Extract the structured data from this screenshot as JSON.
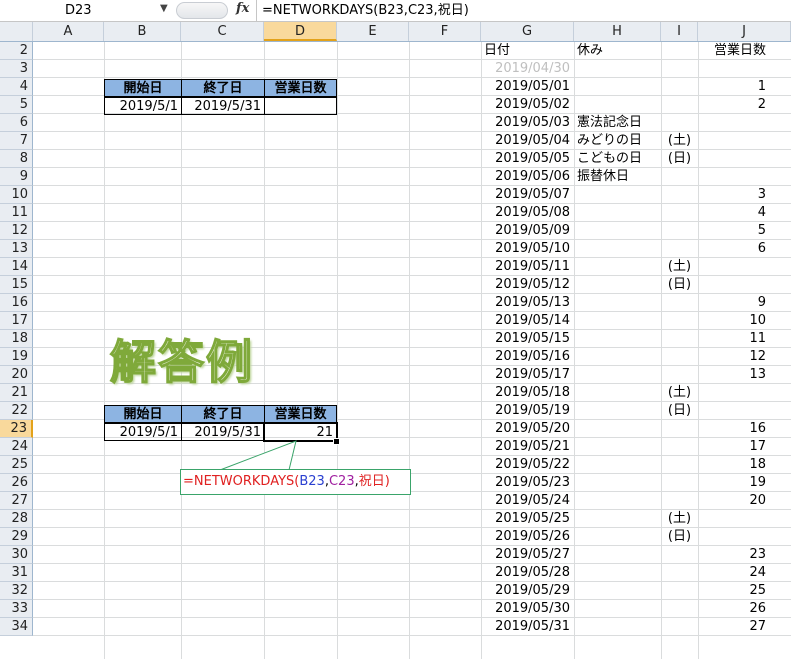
{
  "formula_bar": {
    "name_box": "D23",
    "fx_label": "fx",
    "formula": "=NETWORKDAYS(B23,C23,祝日)"
  },
  "columns": [
    "A",
    "B",
    "C",
    "D",
    "E",
    "F",
    "G",
    "H",
    "I",
    "J"
  ],
  "rows": [
    "2",
    "3",
    "4",
    "5",
    "6",
    "7",
    "8",
    "9",
    "10",
    "11",
    "12",
    "13",
    "14",
    "15",
    "16",
    "17",
    "18",
    "19",
    "20",
    "21",
    "22",
    "23",
    "24",
    "25",
    "26",
    "27",
    "28",
    "29",
    "30",
    "31",
    "32",
    "33",
    "34"
  ],
  "selected": {
    "column": "D",
    "row": "23"
  },
  "list_header": {
    "date": "日付",
    "holiday": "休み",
    "workday": "営業日数"
  },
  "list": [
    {
      "date": "2019/04/30",
      "holiday": "",
      "day": "",
      "count": ""
    },
    {
      "date": "2019/05/01",
      "holiday": "",
      "day": "",
      "count": "1"
    },
    {
      "date": "2019/05/02",
      "holiday": "",
      "day": "",
      "count": "2"
    },
    {
      "date": "2019/05/03",
      "holiday": "憲法記念日",
      "day": "",
      "count": ""
    },
    {
      "date": "2019/05/04",
      "holiday": "みどりの日",
      "day": "(土)",
      "count": ""
    },
    {
      "date": "2019/05/05",
      "holiday": "こどもの日",
      "day": "(日)",
      "count": ""
    },
    {
      "date": "2019/05/06",
      "holiday": "振替休日",
      "day": "",
      "count": ""
    },
    {
      "date": "2019/05/07",
      "holiday": "",
      "day": "",
      "count": "3"
    },
    {
      "date": "2019/05/08",
      "holiday": "",
      "day": "",
      "count": "4"
    },
    {
      "date": "2019/05/09",
      "holiday": "",
      "day": "",
      "count": "5"
    },
    {
      "date": "2019/05/10",
      "holiday": "",
      "day": "",
      "count": "6"
    },
    {
      "date": "2019/05/11",
      "holiday": "",
      "day": "(土)",
      "count": ""
    },
    {
      "date": "2019/05/12",
      "holiday": "",
      "day": "(日)",
      "count": ""
    },
    {
      "date": "2019/05/13",
      "holiday": "",
      "day": "",
      "count": "9"
    },
    {
      "date": "2019/05/14",
      "holiday": "",
      "day": "",
      "count": "10"
    },
    {
      "date": "2019/05/15",
      "holiday": "",
      "day": "",
      "count": "11"
    },
    {
      "date": "2019/05/16",
      "holiday": "",
      "day": "",
      "count": "12"
    },
    {
      "date": "2019/05/17",
      "holiday": "",
      "day": "",
      "count": "13"
    },
    {
      "date": "2019/05/18",
      "holiday": "",
      "day": "(土)",
      "count": ""
    },
    {
      "date": "2019/05/19",
      "holiday": "",
      "day": "(日)",
      "count": ""
    },
    {
      "date": "2019/05/20",
      "holiday": "",
      "day": "",
      "count": "16"
    },
    {
      "date": "2019/05/21",
      "holiday": "",
      "day": "",
      "count": "17"
    },
    {
      "date": "2019/05/22",
      "holiday": "",
      "day": "",
      "count": "18"
    },
    {
      "date": "2019/05/23",
      "holiday": "",
      "day": "",
      "count": "19"
    },
    {
      "date": "2019/05/24",
      "holiday": "",
      "day": "",
      "count": "20"
    },
    {
      "date": "2019/05/25",
      "holiday": "",
      "day": "(土)",
      "count": ""
    },
    {
      "date": "2019/05/26",
      "holiday": "",
      "day": "(日)",
      "count": ""
    },
    {
      "date": "2019/05/27",
      "holiday": "",
      "day": "",
      "count": "23"
    },
    {
      "date": "2019/05/28",
      "holiday": "",
      "day": "",
      "count": "24"
    },
    {
      "date": "2019/05/29",
      "holiday": "",
      "day": "",
      "count": "25"
    },
    {
      "date": "2019/05/30",
      "holiday": "",
      "day": "",
      "count": "26"
    },
    {
      "date": "2019/05/31",
      "holiday": "",
      "day": "",
      "count": "27"
    }
  ],
  "table_top": {
    "headers": [
      "開始日",
      "終了日",
      "営業日数"
    ],
    "values": [
      "2019/5/1",
      "2019/5/31",
      ""
    ]
  },
  "answer_label": "解答例",
  "table_answer": {
    "headers": [
      "開始日",
      "終了日",
      "営業日数"
    ],
    "values": [
      "2019/5/1",
      "2019/5/31",
      "21"
    ]
  },
  "callout": {
    "eq": "=NETWORKDAYS(",
    "arg1": "B23",
    "comma1": ",",
    "arg2": "C23",
    "comma2": ",",
    "arg3": "祝日",
    "close": ")"
  },
  "colors": {
    "header_fill": "#8db4e2",
    "selection": "#f9d99c",
    "callout_border": "#3aa46a"
  }
}
